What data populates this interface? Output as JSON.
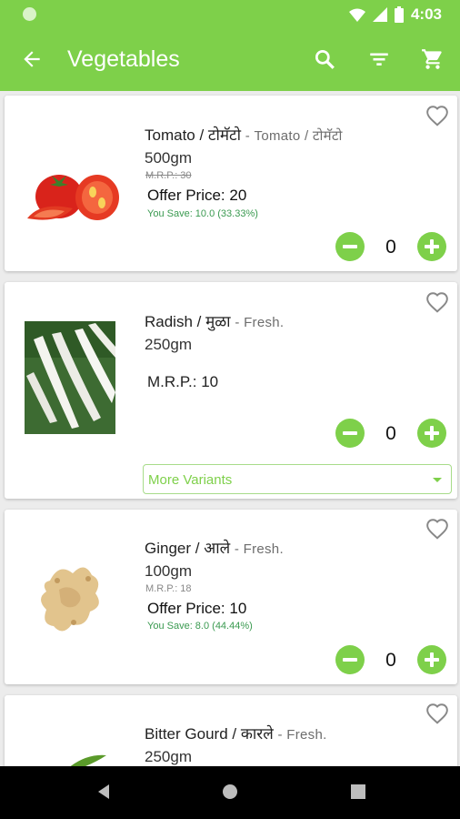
{
  "status_bar": {
    "time": "4:03"
  },
  "app_bar": {
    "title": "Vegetables",
    "background": "#7ed04a",
    "icons": [
      "back-arrow-icon",
      "search-icon",
      "filter-icon",
      "cart-icon"
    ]
  },
  "products": [
    {
      "name": "Tomato / टोमॅटो",
      "subtitle": "- Tomato / टोमॅटो",
      "weight": "500gm",
      "mrp_struck": "M.R.P.: 30",
      "offer_price": "Offer Price: 20",
      "you_save": "You Save: 10.0 (33.33%)",
      "quantity": "0"
    },
    {
      "name": "Radish / मुळा",
      "subtitle": "- Fresh.",
      "weight": "250gm",
      "mrp": "M.R.P.: 10",
      "quantity": "0",
      "variants_label": "More Variants"
    },
    {
      "name": "Ginger / आले",
      "subtitle": "- Fresh.",
      "weight": "100gm",
      "mrp_struck": "M.R.P.: 18",
      "offer_price": "Offer Price: 10",
      "you_save": "You Save: 8.0 (44.44%)",
      "quantity": "0"
    },
    {
      "name": "Bitter Gourd / कारले",
      "subtitle": "- Fresh.",
      "weight": "250gm"
    }
  ],
  "colors": {
    "accent": "#7ed04a",
    "save_text": "#3a9a50"
  }
}
